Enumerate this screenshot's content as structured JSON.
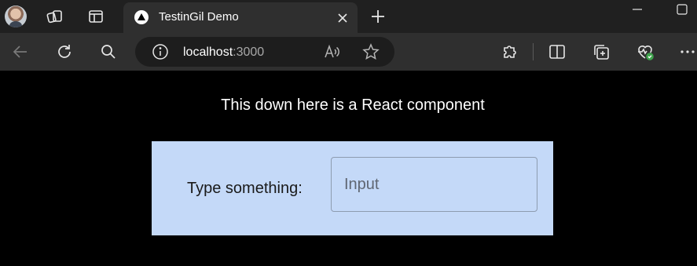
{
  "browser": {
    "tab": {
      "title": "TestinGil Demo"
    },
    "address": {
      "host": "localhost",
      "port": ":3000"
    }
  },
  "page": {
    "heading": "This down here is a React component",
    "form": {
      "label": "Type something:",
      "input_placeholder": "Input",
      "input_value": ""
    }
  },
  "colors": {
    "page_background": "#000000",
    "card_background": "#c4d9f8",
    "tabstrip": "#202020",
    "toolbar": "#2f2f2f"
  },
  "icons": {
    "tabstrip": [
      "profile-avatar",
      "workspaces-icon",
      "vertical-tabs-icon",
      "triangle-favicon",
      "close-icon",
      "plus-icon",
      "minimize-icon",
      "maximize-icon"
    ],
    "toolbar": [
      "back-arrow-icon",
      "refresh-icon",
      "search-icon",
      "info-icon",
      "read-aloud-icon",
      "star-icon",
      "extensions-icon",
      "split-screen-icon",
      "collections-icon",
      "browser-essentials-icon",
      "more-icon"
    ]
  }
}
